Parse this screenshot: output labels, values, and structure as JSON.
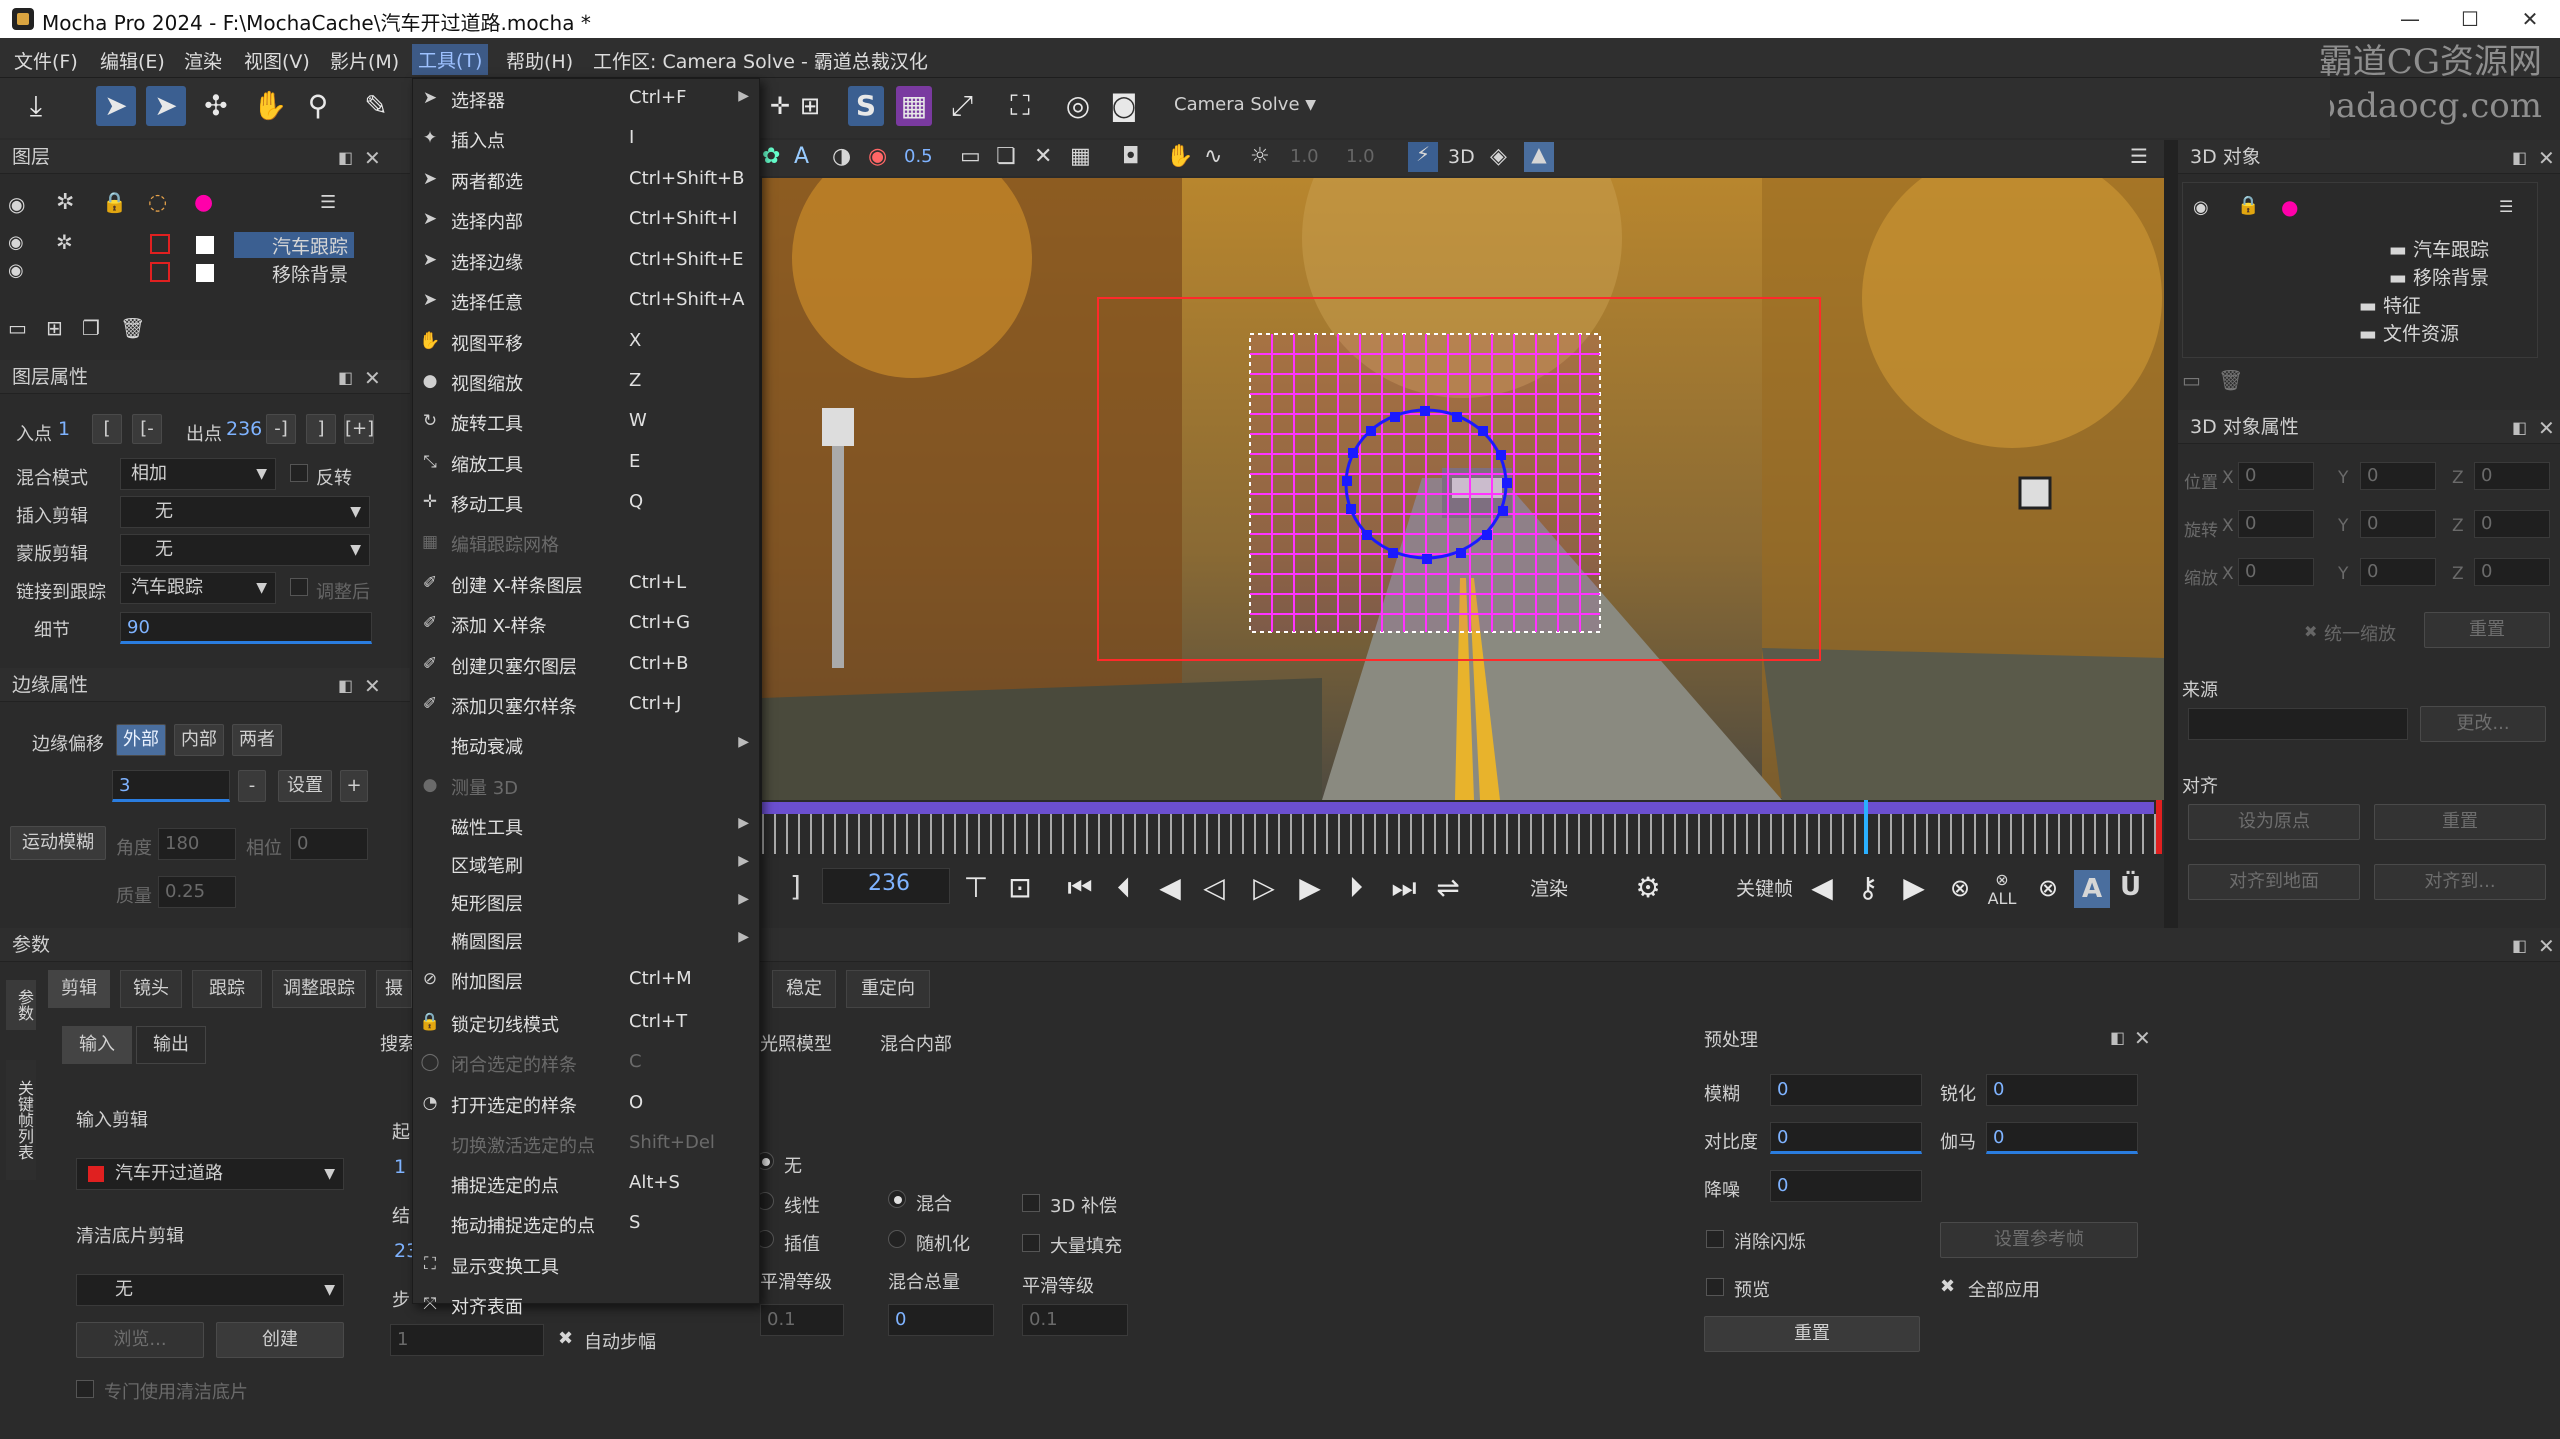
{
  "window": {
    "title": "Mocha Pro 2024 - F:\\MochaCache\\汽车开过道路.mocha *",
    "controls": [
      "—",
      "☐",
      "✕"
    ]
  },
  "menubar": {
    "items": [
      "文件(F)",
      "编辑(E)",
      "渲染",
      "视图(V)",
      "影片(M)",
      "工具(T)",
      "帮助(H)"
    ],
    "workspace": "工作区: Camera Solve - 霸道总裁汉化"
  },
  "watermark": {
    "line1": "霸道CG资源网",
    "line2": "www.badaocg.com"
  },
  "toolbar": {
    "workspace_select": "Camera Solve",
    "opacity_value": "0.5",
    "zoom_value_1": "1.0",
    "zoom_value_2": "1.0",
    "mode_3d": "3D"
  },
  "layers_panel": {
    "title": "图层",
    "layers": [
      "汽车跟踪",
      "移除背景"
    ]
  },
  "layer_props": {
    "title": "图层属性",
    "in_label": "入点",
    "in_value": "1",
    "out_label": "出点",
    "out_value": "236",
    "blend_label": "混合模式",
    "blend_value": "相加",
    "invert_label": "反转",
    "insert_clip_label": "插入剪辑",
    "insert_clip_value": "无",
    "matte_clip_label": "蒙版剪辑",
    "matte_clip_value": "无",
    "link_label": "链接到跟踪",
    "link_value": "汽车跟踪",
    "adjust_label": "调整后",
    "detail_label": "细节",
    "detail_value": "90"
  },
  "edge_props": {
    "title": "边缘属性",
    "offset_label": "边缘偏移",
    "offset_tabs": [
      "外部",
      "内部",
      "两者"
    ],
    "offset_value": "3",
    "minus": "-",
    "set_label": "设置",
    "plus": "+",
    "motion_blur_label": "运动模糊",
    "angle_label": "角度",
    "angle_value": "180",
    "phase_label": "相位",
    "phase_value": "0",
    "quality_label": "质量",
    "quality_value": "0.25"
  },
  "params": {
    "title": "参数",
    "side_tabs": [
      "参数",
      "关键帧列表"
    ],
    "tabs": [
      "剪辑",
      "镜头",
      "跟踪",
      "调整跟踪",
      "摄"
    ],
    "right_tabs": [
      "稳定",
      "重定向"
    ],
    "io_tabs": [
      "输入",
      "输出"
    ],
    "input_clip_label": "输入剪辑",
    "input_clip_value": "汽车开过道路",
    "clean_plate_label": "清洁底片剪辑",
    "clean_plate_value": "无",
    "btn_browse": "浏览...",
    "btn_create": "创建",
    "exclusive_label": "专门使用清洁底片",
    "search_label": "搜索",
    "start_label": "起",
    "start_value": "1",
    "end_label": "结",
    "end_value": "23",
    "step_label": "步",
    "step_value": "1",
    "auto_step_label": "自动步幅",
    "illum_model_label": "光照模型",
    "blend_inner_label": "混合内部",
    "radio_none": "无",
    "radio_linear": "线性",
    "radio_interp": "插值",
    "radio_blend": "混合",
    "radio_random": "随机化",
    "chk_3d": "3D 补偿",
    "chk_bulk": "大量填充",
    "smooth_label_1": "平滑等级",
    "smooth_value_1": "0.1",
    "blend_total_label": "混合总量",
    "blend_total_value": "0",
    "smooth_label_2": "平滑等级",
    "smooth_value_2": "0.1"
  },
  "preprocess": {
    "title": "预处理",
    "blur_label": "模糊",
    "blur_value": "0",
    "sharpen_label": "锐化",
    "sharpen_value": "0",
    "contrast_label": "对比度",
    "contrast_value": "0",
    "gamma_label": "伽马",
    "gamma_value": "0",
    "denoise_label": "降噪",
    "denoise_value": "0",
    "deflicker_label": "消除闪烁",
    "set_ref_label": "设置参考帧",
    "preview_label": "预览",
    "apply_all_label": "全部应用",
    "reset_label": "重置"
  },
  "objects_3d": {
    "title": "3D 对象",
    "tree": [
      "汽车跟踪",
      "移除背景",
      "特征",
      "文件资源"
    ]
  },
  "objects_3d_props": {
    "title": "3D 对象属性",
    "pos_label": "位置",
    "rot_label": "旋转",
    "scale_label": "缩放",
    "x": "X",
    "y": "Y",
    "z": "Z",
    "zero": "0",
    "uniform_scale_label": "统一缩放",
    "reset_label": "重置",
    "source_label": "来源",
    "change_label": "更改...",
    "align_label": "对齐",
    "set_origin_label": "设为原点",
    "align_reset_label": "重置",
    "align_ground_label": "对齐到地面",
    "align_to_label": "对齐到..."
  },
  "playback": {
    "frame": "236",
    "render_label": "渲染",
    "keyframe_label": "关键帧",
    "all_label": "ALL",
    "a_label": "A",
    "u_label": "Ü"
  },
  "tools_menu": {
    "items": [
      {
        "label": "选择器",
        "shortcut": "Ctrl+F",
        "icon": "select-icon",
        "submenu": true,
        "disabled": false
      },
      {
        "label": "插入点",
        "shortcut": "I",
        "icon": "insert-point-icon",
        "submenu": false,
        "disabled": false
      },
      {
        "label": "两者都选",
        "shortcut": "Ctrl+Shift+B",
        "icon": "select-both-icon",
        "submenu": false,
        "disabled": false
      },
      {
        "label": "选择内部",
        "shortcut": "Ctrl+Shift+I",
        "icon": "select-inner-icon",
        "submenu": false,
        "disabled": false
      },
      {
        "label": "选择边缘",
        "shortcut": "Ctrl+Shift+E",
        "icon": "select-edge-icon",
        "submenu": false,
        "disabled": false
      },
      {
        "label": "选择任意",
        "shortcut": "Ctrl+Shift+A",
        "icon": "select-any-icon",
        "submenu": false,
        "disabled": false
      },
      {
        "label": "视图平移",
        "shortcut": "X",
        "icon": "hand-icon",
        "submenu": false,
        "disabled": false
      },
      {
        "label": "视图缩放",
        "shortcut": "Z",
        "icon": "zoom-icon",
        "submenu": false,
        "disabled": false
      },
      {
        "label": "旋转工具",
        "shortcut": "W",
        "icon": "rotate-icon",
        "submenu": false,
        "disabled": false
      },
      {
        "label": "缩放工具",
        "shortcut": "E",
        "icon": "scale-icon",
        "submenu": false,
        "disabled": false
      },
      {
        "label": "移动工具",
        "shortcut": "Q",
        "icon": "move-icon",
        "submenu": false,
        "disabled": false
      },
      {
        "label": "编辑跟踪网格",
        "shortcut": "",
        "icon": "grid-icon",
        "submenu": false,
        "disabled": true
      },
      {
        "label": "创建 X-样条图层",
        "shortcut": "Ctrl+L",
        "icon": "xspline-icon",
        "submenu": false,
        "disabled": false
      },
      {
        "label": "添加 X-样条",
        "shortcut": "Ctrl+G",
        "icon": "add-xspline-icon",
        "submenu": false,
        "disabled": false
      },
      {
        "label": "创建贝塞尔图层",
        "shortcut": "Ctrl+B",
        "icon": "bezier-icon",
        "submenu": false,
        "disabled": false
      },
      {
        "label": "添加贝塞尔样条",
        "shortcut": "Ctrl+J",
        "icon": "add-bezier-icon",
        "submenu": false,
        "disabled": false
      },
      {
        "label": "拖动衰减",
        "shortcut": "",
        "icon": "",
        "submenu": true,
        "disabled": false
      },
      {
        "label": "测量 3D",
        "shortcut": "",
        "icon": "measure-icon",
        "submenu": false,
        "disabled": true
      },
      {
        "label": "磁性工具",
        "shortcut": "",
        "icon": "",
        "submenu": true,
        "disabled": false
      },
      {
        "label": "区域笔刷",
        "shortcut": "",
        "icon": "",
        "submenu": true,
        "disabled": false
      },
      {
        "label": "矩形图层",
        "shortcut": "",
        "icon": "",
        "submenu": true,
        "disabled": false
      },
      {
        "label": "椭圆图层",
        "shortcut": "",
        "icon": "",
        "submenu": true,
        "disabled": false
      },
      {
        "label": "附加图层",
        "shortcut": "Ctrl+M",
        "icon": "attach-icon",
        "submenu": false,
        "disabled": false
      },
      {
        "label": "锁定切线模式",
        "shortcut": "Ctrl+T",
        "icon": "lock-icon",
        "submenu": false,
        "disabled": false
      },
      {
        "label": "闭合选定的样条",
        "shortcut": "C",
        "icon": "close-spline-icon",
        "submenu": false,
        "disabled": true
      },
      {
        "label": "打开选定的样条",
        "shortcut": "O",
        "icon": "open-spline-icon",
        "submenu": false,
        "disabled": false
      },
      {
        "label": "切换激活选定的点",
        "shortcut": "Shift+Del",
        "icon": "",
        "submenu": false,
        "disabled": true
      },
      {
        "label": "捕捉选定的点",
        "shortcut": "Alt+S",
        "icon": "",
        "submenu": false,
        "disabled": false
      },
      {
        "label": "拖动捕捉选定的点",
        "shortcut": "S",
        "icon": "",
        "submenu": false,
        "disabled": false
      },
      {
        "label": "显示变换工具",
        "shortcut": "",
        "icon": "transform-icon",
        "submenu": false,
        "disabled": false
      },
      {
        "label": "对齐表面",
        "shortcut": "",
        "icon": "align-surface-icon",
        "submenu": false,
        "disabled": false
      }
    ]
  }
}
